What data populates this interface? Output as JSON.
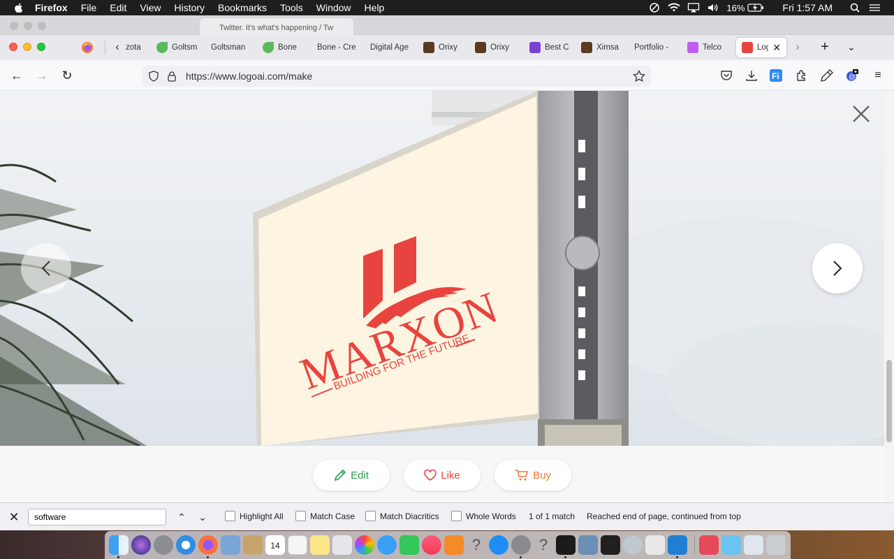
{
  "menubar": {
    "app_name": "Firefox",
    "items": [
      "File",
      "Edit",
      "View",
      "History",
      "Bookmarks",
      "Tools",
      "Window",
      "Help"
    ],
    "battery": "16%",
    "clock": "Fri 1:57 AM"
  },
  "background_window": {
    "tab_title": "Twitter. It's what's happening / Tw"
  },
  "tabs": [
    {
      "label": "zota",
      "favicon": "none"
    },
    {
      "label": "Goltsm",
      "favicon": "leaf-icon"
    },
    {
      "label": "Goltsman",
      "favicon": "none"
    },
    {
      "label": "Bone",
      "favicon": "leaf-icon"
    },
    {
      "label": "Bone - Cre",
      "favicon": "none"
    },
    {
      "label": "Digital Age",
      "favicon": "none"
    },
    {
      "label": "Orixy",
      "favicon": "photo-icon"
    },
    {
      "label": "Orixy",
      "favicon": "photo-icon"
    },
    {
      "label": "Best C",
      "favicon": "swirl-icon"
    },
    {
      "label": "Ximsa",
      "favicon": "photo-icon"
    },
    {
      "label": "Portfolio -",
      "favicon": "none"
    },
    {
      "label": "Telco",
      "favicon": "telco-icon"
    },
    {
      "label": "Log",
      "favicon": "logoai-icon",
      "active": true
    }
  ],
  "navbar": {
    "url": "https://www.logoai.com/make"
  },
  "logo": {
    "name": "MARXON",
    "tagline": "BUILDING FOR THE FUTURE",
    "color": "#e8443f"
  },
  "actions": {
    "edit": "Edit",
    "like": "Like",
    "buy": "Buy"
  },
  "findbar": {
    "query": "software",
    "highlight_all": "Highlight All",
    "match_case": "Match Case",
    "match_diacritics": "Match Diacritics",
    "whole_words": "Whole Words",
    "match_count": "1 of 1 match",
    "status": "Reached end of page, continued from top"
  },
  "dock": {
    "calendar_day": "14"
  }
}
